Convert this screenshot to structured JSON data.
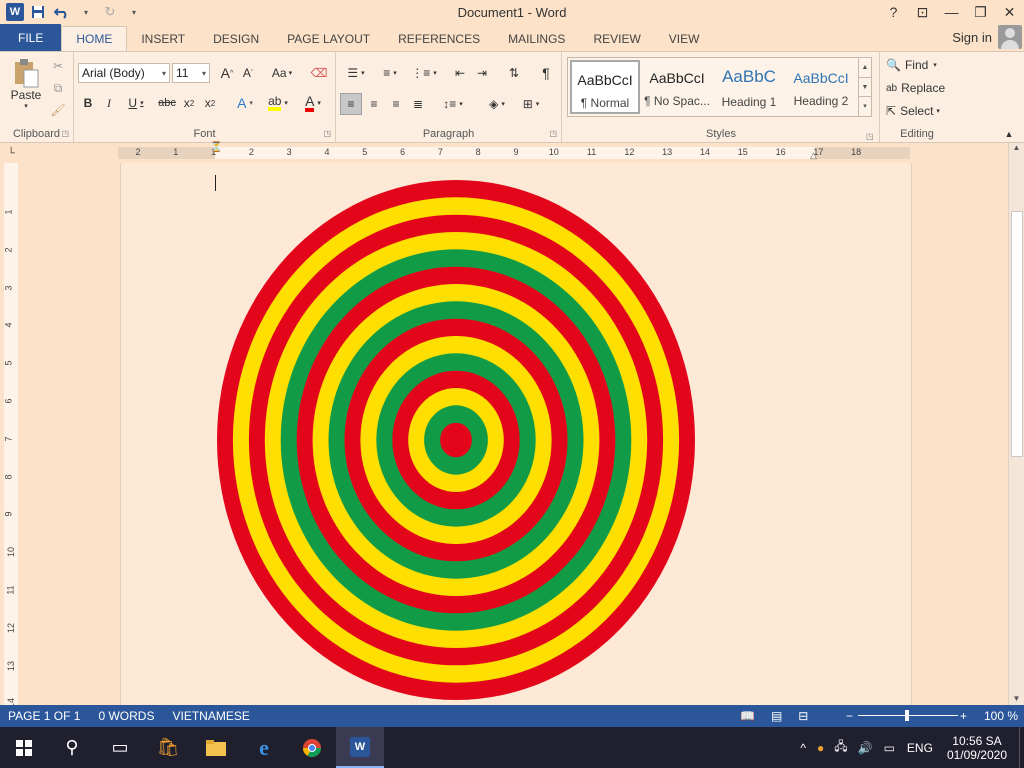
{
  "app": {
    "title": "Document1 - Word",
    "word_logo": "W"
  },
  "qat": {
    "save_icon": "save-icon",
    "undo_icon": "undo-icon",
    "redo_icon": "redo-icon"
  },
  "window": {
    "help": "?",
    "restore_ribbon": "⊡",
    "minimize": "—",
    "maximize": "❐",
    "close": "✕"
  },
  "tabs": [
    "FILE",
    "HOME",
    "INSERT",
    "DESIGN",
    "PAGE LAYOUT",
    "REFERENCES",
    "MAILINGS",
    "REVIEW",
    "VIEW"
  ],
  "active_tab": "HOME",
  "signin": "Sign in",
  "ribbon": {
    "clipboard": {
      "label": "Clipboard",
      "paste": "Paste"
    },
    "font": {
      "label": "Font",
      "name": "Arial (Body)",
      "size": "11",
      "case": "Aa"
    },
    "paragraph": {
      "label": "Paragraph"
    },
    "styles": {
      "label": "Styles",
      "items": [
        {
          "preview": "AaBbCcI",
          "name": "¶ Normal"
        },
        {
          "preview": "AaBbCcI",
          "name": "¶ No Spac..."
        },
        {
          "preview": "AaBbC",
          "name": "Heading 1"
        },
        {
          "preview": "AaBbCcI",
          "name": "Heading 2"
        }
      ]
    },
    "editing": {
      "label": "Editing",
      "find": "Find",
      "replace": "Replace",
      "select": "Select"
    }
  },
  "ruler": {
    "h_ticks": [
      "2",
      "1",
      "1",
      "2",
      "3",
      "4",
      "5",
      "6",
      "7",
      "8",
      "9",
      "10",
      "11",
      "12",
      "13",
      "14",
      "15",
      "16",
      "17",
      "18"
    ],
    "v_ticks": [
      "1",
      "2",
      "3",
      "4",
      "5",
      "6",
      "7",
      "8",
      "9",
      "10",
      "11",
      "12",
      "13",
      "14"
    ]
  },
  "drawing": {
    "rings": [
      "#e3061b",
      "#ffdf00",
      "#e3061b",
      "#ffdf00",
      "#129b46",
      "#e3061b",
      "#ffdf00",
      "#129b46",
      "#e3061b",
      "#ffdf00",
      "#129b46",
      "#e3061b",
      "#ffdf00",
      "#129b46",
      "#e3061b"
    ]
  },
  "status": {
    "page": "PAGE 1 OF 1",
    "words": "0 WORDS",
    "language": "VIETNAMESE",
    "zoom": "100 %"
  },
  "taskbar": {
    "lang": "ENG",
    "time": "10:56 SA",
    "date": "01/09/2020"
  },
  "colors": {
    "accent": "#2b579a",
    "page": "#fde9d6",
    "ribbon": "#fcefe2"
  }
}
